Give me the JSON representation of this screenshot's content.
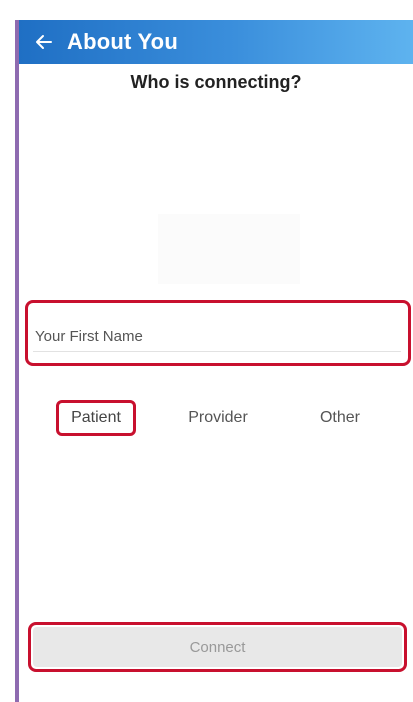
{
  "header": {
    "title": "About You",
    "back_icon": "arrow-left-icon"
  },
  "subtitle": "Who is connecting?",
  "name_field": {
    "placeholder": "Your First Name",
    "value": ""
  },
  "roles": [
    {
      "label": "Patient"
    },
    {
      "label": "Provider"
    },
    {
      "label": "Other"
    }
  ],
  "connect_label": "Connect",
  "colors": {
    "header_start": "#1f6fc4",
    "header_end": "#5eb3ef",
    "highlight": "#c8102e",
    "frame": "#8e6bb0",
    "button_bg": "#e8e8e8",
    "button_text": "#999999"
  }
}
